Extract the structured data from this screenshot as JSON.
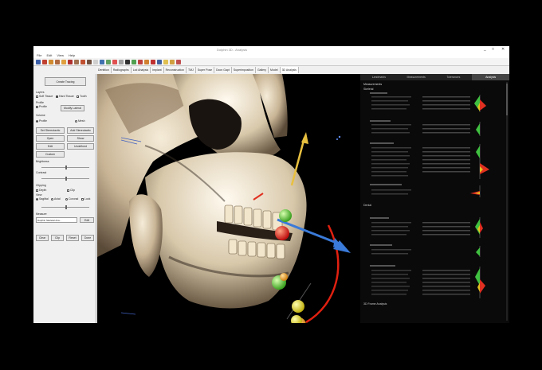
{
  "window": {
    "title": "Dolphin 3D - Analysis",
    "minimize": "_",
    "maximize": "□",
    "close": "✕"
  },
  "menu": [
    "File",
    "Edit",
    "View",
    "Help"
  ],
  "toolbar_colors": [
    "#3a5fa8",
    "#c04030",
    "#d08a30",
    "#b06a40",
    "#e0a040",
    "#b03030",
    "#a07050",
    "#c05030",
    "#705040",
    "#d0d0d0",
    "#4070b0",
    "#60a060",
    "#e05050",
    "#a0a0a0",
    "#303030",
    "#50a050",
    "#c04040",
    "#d08030",
    "#c03030",
    "#4060a0",
    "#e0c050",
    "#d0a040",
    "#c05050"
  ],
  "tabs": [
    "Dentition",
    "Radiographs",
    "Lcd Ahalysis",
    "Implant",
    "Reconstruction",
    "TMJ",
    "Super Pose",
    "Dcon Gapt",
    "Superimposition",
    "Gallery",
    "Model",
    "3D Analysis"
  ],
  "left_panel": {
    "main_button": "Create Tracing",
    "labels": {
      "layers": "Layers",
      "profile": "Profile",
      "volume": "Volume",
      "opacity": "Opacity",
      "brightness": "Brightness",
      "contrast": "Contrast",
      "clipping": "Clipping",
      "view": "View",
      "measure": "Measure"
    },
    "layer_checks": [
      "Soft Tissue",
      "Hard Tissue",
      "Tooth"
    ],
    "profile_row": [
      "Profile",
      "Modify Lateral"
    ],
    "volume_row": [
      "Profile",
      "Mesh"
    ],
    "buttons": [
      "Set Stereotactic",
      "Add Stereotactic",
      "Open",
      "Show",
      "Edit",
      "Undefined",
      "Custom"
    ],
    "clip_checks": [
      "Depth",
      "Clip"
    ],
    "view_checks": [
      "Sagittal",
      "Axial",
      "Coronal",
      "Lock"
    ],
    "measure_input": "Dolphin Skeletal Ana...",
    "measure_btn": "Edit",
    "bottom_buttons": [
      "Clear",
      "Clip",
      "Reset",
      "Done"
    ]
  },
  "right_panel": {
    "tabs": [
      "Landmarks",
      "Measurements",
      "Tolerances",
      "Analysis"
    ],
    "active_tab": 3,
    "header_meas": "Measurements",
    "sections": [
      "Skeletal",
      "Dental",
      "3D Frame Analysis"
    ]
  }
}
